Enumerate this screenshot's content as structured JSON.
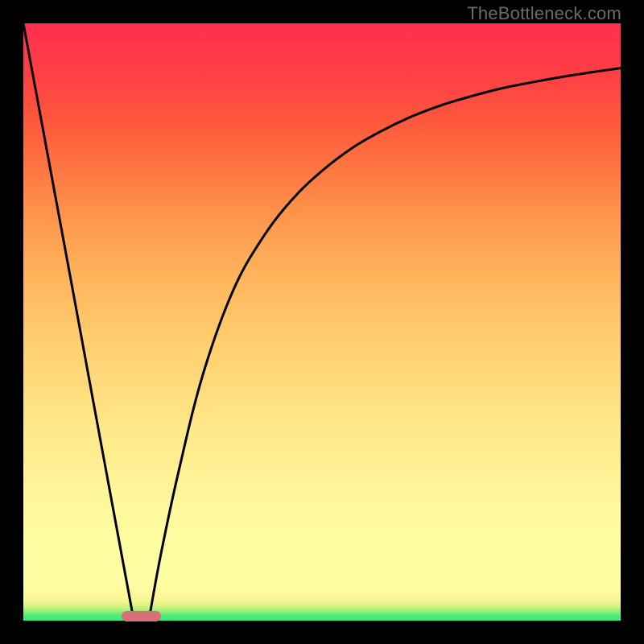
{
  "watermark": "TheBottleneck.com",
  "colors": {
    "frame": "#000000",
    "curve": "#000000",
    "marker": "#d77077"
  },
  "chart_data": {
    "type": "line",
    "title": "",
    "xlabel": "",
    "ylabel": "",
    "xlim": [
      0,
      100
    ],
    "ylim": [
      0,
      100
    ],
    "grid": false,
    "legend": false,
    "series": [
      {
        "name": "left-branch",
        "x": [
          0,
          3,
          6,
          9,
          12,
          15,
          17,
          18.5
        ],
        "y": [
          100,
          83.8,
          67.6,
          51.4,
          35.1,
          18.9,
          8.1,
          0
        ]
      },
      {
        "name": "right-branch",
        "x": [
          21,
          23,
          26,
          30,
          35,
          40,
          45,
          50,
          55,
          60,
          65,
          70,
          75,
          80,
          85,
          90,
          95,
          100
        ],
        "y": [
          0,
          11,
          25,
          41,
          55,
          64,
          70.5,
          75.3,
          79.1,
          82,
          84.4,
          86.3,
          87.8,
          89.1,
          90.1,
          91,
          91.8,
          92.5
        ]
      }
    ],
    "annotations": [
      {
        "name": "bottom-marker",
        "shape": "pill",
        "x_center": 19.7,
        "y_center": 0.7,
        "width": 6.6,
        "height": 1.8,
        "color": "#d77077"
      }
    ]
  }
}
